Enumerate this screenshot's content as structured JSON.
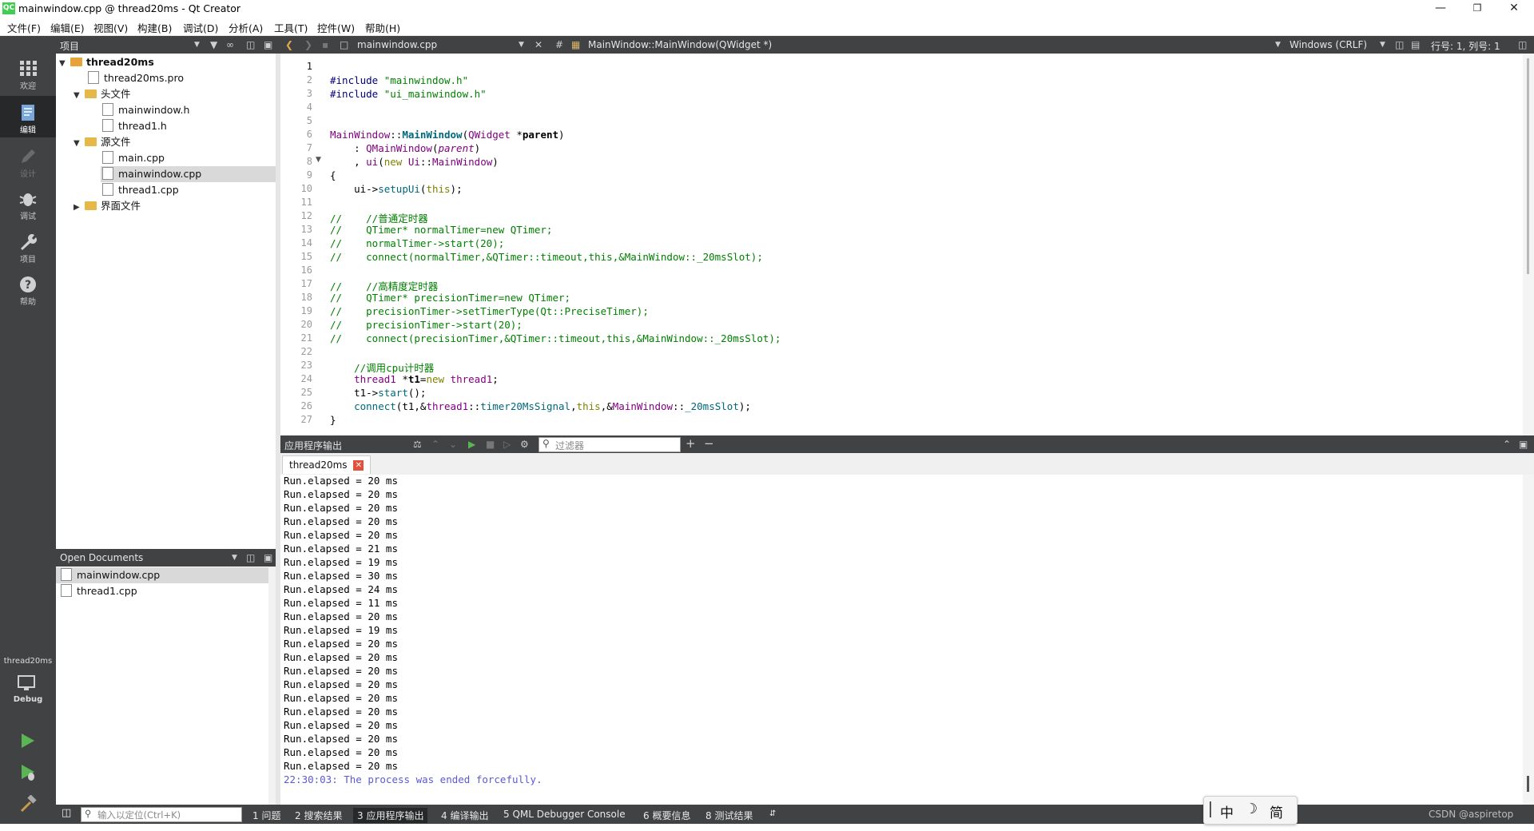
{
  "window": {
    "title": "mainwindow.cpp @ thread20ms - Qt Creator",
    "logo": "QC"
  },
  "menu": [
    "文件(F)",
    "编辑(E)",
    "视图(V)",
    "构建(B)",
    "调试(D)",
    "分析(A)",
    "工具(T)",
    "控件(W)",
    "帮助(H)"
  ],
  "modes": [
    {
      "label": "欢迎",
      "icon": "grid-icon"
    },
    {
      "label": "编辑",
      "icon": "edit-icon"
    },
    {
      "label": "设计",
      "icon": "pencil-icon"
    },
    {
      "label": "调试",
      "icon": "bug-icon"
    },
    {
      "label": "项目",
      "icon": "wrench-icon"
    },
    {
      "label": "帮助",
      "icon": "help-icon"
    }
  ],
  "target": {
    "project": "thread20ms",
    "config": "Debug"
  },
  "projects_pane": {
    "title": "项目"
  },
  "tree": {
    "root": "thread20ms",
    "pro": "thread20ms.pro",
    "headers": "头文件",
    "header_files": [
      "mainwindow.h",
      "thread1.h"
    ],
    "sources": "源文件",
    "source_files": [
      "main.cpp",
      "mainwindow.cpp",
      "thread1.cpp"
    ],
    "forms": "界面文件"
  },
  "open_docs": {
    "title": "Open Documents",
    "files": [
      "mainwindow.cpp",
      "thread1.cpp"
    ]
  },
  "editor_toolbar": {
    "file": "mainwindow.cpp",
    "symbol": "MainWindow::MainWindow(QWidget *)",
    "line_ending": "Windows (CRLF)",
    "position": "行号: 1, 列号: 1"
  },
  "code": {
    "line_numbers": [
      "1",
      "2",
      "3",
      "4",
      "5",
      "6",
      "7",
      "8",
      "9",
      "10",
      "11",
      "12",
      "13",
      "14",
      "15",
      "16",
      "17",
      "18",
      "19",
      "20",
      "21",
      "22",
      "23",
      "24",
      "25",
      "26",
      "27"
    ],
    "l2": [
      "#include ",
      "\"mainwindow.h\""
    ],
    "l3": [
      "#include ",
      "\"ui_mainwindow.h\""
    ],
    "l6": [
      "MainWindow",
      "::",
      "MainWindow",
      "(",
      "QWidget",
      " *",
      "parent",
      ")"
    ],
    "l7": [
      "    : ",
      "QMainWindow",
      "(",
      "parent",
      ")"
    ],
    "l8": [
      "    , ",
      "ui",
      "(",
      "new",
      " ",
      "Ui",
      "::",
      "MainWindow",
      ")"
    ],
    "l9": "{",
    "l10": [
      "    ui->",
      "setupUi",
      "(",
      "this",
      ");"
    ],
    "l12": "//    //普通定时器",
    "l13": "//    QTimer* normalTimer=new QTimer;",
    "l14": "//    normalTimer->start(20);",
    "l15": "//    connect(normalTimer,&QTimer::timeout,this,&MainWindow::_20msSlot);",
    "l17": "//    //高精度定时器",
    "l18": "//    QTimer* precisionTimer=new QTimer;",
    "l19": "//    precisionTimer->setTimerType(Qt::PreciseTimer);",
    "l20": "//    precisionTimer->start(20);",
    "l21": "//    connect(precisionTimer,&QTimer::timeout,this,&MainWindow::_20msSlot);",
    "l23": "    //调用cpu计时器",
    "l24": [
      "    ",
      "thread1",
      " *",
      "t1",
      "=",
      "new",
      " ",
      "thread1",
      ";"
    ],
    "l25": [
      "    t1->",
      "start",
      "();"
    ],
    "l26": [
      "    ",
      "connect",
      "(t1,&",
      "thread1",
      "::",
      "timer20MsSignal",
      ",",
      "this",
      ",&",
      "MainWindow",
      "::",
      "_20msSlot",
      ");"
    ],
    "l27": "}"
  },
  "output_pane": {
    "title": "应用程序输出",
    "filter_placeholder": "过滤器",
    "tab": "thread20ms",
    "lines": [
      "Run.elapsed = 20 ms",
      "Run.elapsed = 20 ms",
      "Run.elapsed = 20 ms",
      "Run.elapsed = 20 ms",
      "Run.elapsed = 20 ms",
      "Run.elapsed = 21 ms",
      "Run.elapsed = 19 ms",
      "Run.elapsed = 30 ms",
      "Run.elapsed = 24 ms",
      "Run.elapsed = 11 ms",
      "Run.elapsed = 20 ms",
      "Run.elapsed = 19 ms",
      "Run.elapsed = 20 ms",
      "Run.elapsed = 20 ms",
      "Run.elapsed = 20 ms",
      "Run.elapsed = 20 ms",
      "Run.elapsed = 20 ms",
      "Run.elapsed = 20 ms",
      "Run.elapsed = 20 ms",
      "Run.elapsed = 20 ms",
      "Run.elapsed = 20 ms",
      "Run.elapsed = 20 ms"
    ],
    "end_message": "22:30:03: The process was ended forcefully."
  },
  "status": {
    "locator_placeholder": "输入以定位(Ctrl+K)",
    "tabs": [
      "1 问题",
      "2 搜索结果",
      "3 应用程序输出",
      "4 编译输出",
      "5 QML Debugger Console",
      "6 概要信息",
      "8 测试结果"
    ],
    "ime": [
      "中",
      "简"
    ],
    "watermark": "CSDN @aspiretop"
  },
  "colors": {
    "sidebar": "#404244",
    "active_mode": "#262829",
    "end_message": "#5a5ad6",
    "qt_green": "#41cd52"
  }
}
